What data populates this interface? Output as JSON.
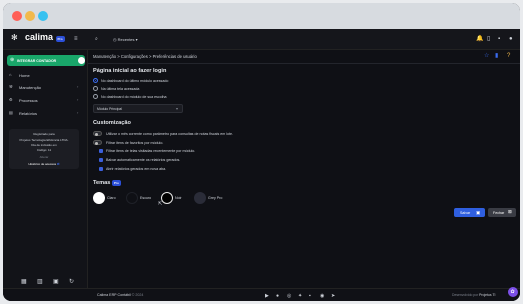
{
  "app": {
    "name": "calima",
    "badge": "Pro",
    "accent": "#2b4fd8"
  },
  "topbar": {
    "search_icon": "search-icon",
    "recents_label": "Recentes"
  },
  "sidebar": {
    "primary_button": "INTEGRAR CONTADOR",
    "items": [
      {
        "label": "Home",
        "icon": "home-icon"
      },
      {
        "label": "Manutenção",
        "icon": "wrench-icon"
      },
      {
        "label": "Processos",
        "icon": "cog-icon"
      },
      {
        "label": "Relatórios",
        "icon": "report-icon"
      }
    ],
    "card": {
      "line1": "Registrado para",
      "line2": "Projetus Tecnologia Eficiência LTDA.",
      "line3": "Dia de inclusão em",
      "line4": "Código: 11",
      "link1": "Alterar",
      "link2": "Histórico de acessos"
    },
    "bottom_icons": [
      "calendar-icon",
      "trash-icon",
      "copy-icon",
      "refresh-icon"
    ]
  },
  "breadcrumb": "Manutenção > Configurações > Preferências de usuário",
  "page_start": {
    "title": "Página inicial ao fazer login",
    "options": [
      "No dashboard do último módulo acessado",
      "Na última tela acessada",
      "No dashboard do módulo de sua escolha"
    ],
    "selected_index": 0,
    "select_value": "Módulo Principal"
  },
  "custom": {
    "title": "Customização",
    "toggles": [
      "Utilizar o mês corrente como parâmetro para consultas de notas fiscais em lote.",
      "Filtrar itens de favoritos por módulo."
    ],
    "checks": [
      "Filtrar itens de telas visitadas recentemente por módulo.",
      "Baixar automaticamente os relatórios gerados.",
      "Abrir relatórios gerados em nova aba."
    ]
  },
  "themes": {
    "title": "Temas",
    "badge": "Pro",
    "options": [
      {
        "label": "Claro",
        "color": "#ffffff"
      },
      {
        "label": "Escuro",
        "color": "#0f1015"
      },
      {
        "label": "Noir",
        "color": "#000000"
      },
      {
        "label": "Grey Pro",
        "color": "#2a2c38"
      }
    ]
  },
  "actions": {
    "save": "Salvar",
    "close": "Fechar"
  },
  "footer": {
    "left": "Calima ERP Contábil",
    "left_muted": "© 2024",
    "right": "Desenvolvido por",
    "right_brand": "Projetus TI",
    "social_icons": [
      "youtube-icon",
      "facebook-icon",
      "instagram-icon",
      "twitter-icon",
      "linkedin-icon",
      "whatsapp-icon",
      "telegram-icon"
    ]
  }
}
